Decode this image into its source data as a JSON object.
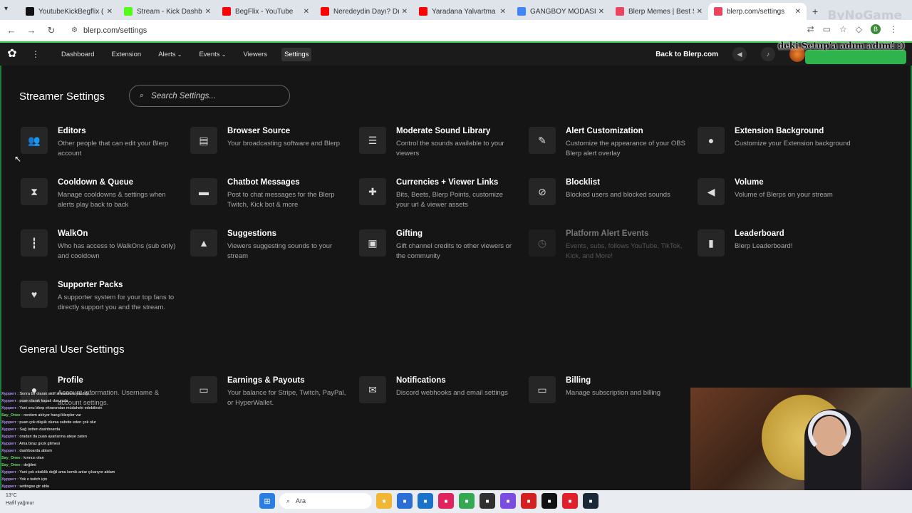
{
  "browser": {
    "tabs": [
      {
        "title": "YoutubeKickBegflix (@you...",
        "color": "#111111",
        "active": false
      },
      {
        "title": "Stream - Kick Dashboard",
        "color": "#53fc18",
        "active": false
      },
      {
        "title": "BegFlix - YouTube",
        "color": "#ff0000",
        "active": false
      },
      {
        "title": "Neredeydin Dayı? Dışarıdı...",
        "color": "#ff0000",
        "active": false
      },
      {
        "title": "Yaradana Yalvartma -",
        "color": "#ff0000",
        "active": false
      },
      {
        "title": "GANGBOY MODASI - Goo...",
        "color": "#4285f4",
        "active": false
      },
      {
        "title": "Blerp Memes | Best Strea...",
        "color": "#e94560",
        "active": false
      },
      {
        "title": "blerp.com/settings",
        "color": "#e94560",
        "active": true
      }
    ],
    "url": "blerp.com/settings",
    "watermark": "ByNoGame",
    "profile_initial": "B"
  },
  "overlay_text": "deki Setup'a adım adım! :)",
  "topnav": {
    "items": [
      {
        "label": "Dashboard",
        "selected": false,
        "dropdown": false
      },
      {
        "label": "Extension",
        "selected": false,
        "dropdown": false
      },
      {
        "label": "Alerts",
        "selected": false,
        "dropdown": true
      },
      {
        "label": "Events",
        "selected": false,
        "dropdown": true
      },
      {
        "label": "Viewers",
        "selected": false,
        "dropdown": false
      },
      {
        "label": "Settings",
        "selected": true,
        "dropdown": false
      }
    ],
    "back_link": "Back to Blerp.com"
  },
  "streamer_settings": {
    "title": "Streamer Settings",
    "search_placeholder": "Search Settings...",
    "cards": [
      {
        "title": "Editors",
        "desc": "Other people that can edit your Blerp account",
        "icon": "people-icon",
        "glyph": "👥",
        "dim": false
      },
      {
        "title": "Browser Source",
        "desc": "Your broadcasting software and Blerp",
        "icon": "browser-icon",
        "glyph": "▤",
        "dim": false
      },
      {
        "title": "Moderate Sound Library",
        "desc": "Control the sounds available to your viewers",
        "icon": "sliders-icon",
        "glyph": "☰",
        "dim": false
      },
      {
        "title": "Alert Customization",
        "desc": "Customize the appearance of your OBS Blerp alert overlay",
        "icon": "magic-wand-icon",
        "glyph": "✎",
        "dim": false
      },
      {
        "title": "Extension Background",
        "desc": "Customize your Extension background",
        "icon": "palette-icon",
        "glyph": "●",
        "dim": false
      },
      {
        "title": "Cooldown & Queue",
        "desc": "Manage cooldowns & settings when alerts play back to back",
        "icon": "hourglass-icon",
        "glyph": "⧗",
        "dim": false
      },
      {
        "title": "Chatbot Messages",
        "desc": "Post to chat messages for the Blerp Twitch, Kick bot & more",
        "icon": "chat-icon",
        "glyph": "▬",
        "dim": false
      },
      {
        "title": "Currencies + Viewer Links",
        "desc": "Bits, Beets, Blerp Points, customize your url & viewer assets",
        "icon": "puzzle-icon",
        "glyph": "✚",
        "dim": false
      },
      {
        "title": "Blocklist",
        "desc": "Blocked users and blocked sounds",
        "icon": "block-icon",
        "glyph": "⊘",
        "dim": false
      },
      {
        "title": "Volume",
        "desc": "Volume of Blerps on your stream",
        "icon": "volume-icon",
        "glyph": "◀",
        "dim": false
      },
      {
        "title": "WalkOn",
        "desc": "Who has access to WalkOns (sub only) and cooldown",
        "icon": "walk-icon",
        "glyph": "┇",
        "dim": false
      },
      {
        "title": "Suggestions",
        "desc": "Viewers suggesting sounds to your stream",
        "icon": "thumbs-up-icon",
        "glyph": "▲",
        "dim": false
      },
      {
        "title": "Gifting",
        "desc": "Gift channel credits to other viewers or the community",
        "icon": "gift-icon",
        "glyph": "▣",
        "dim": false
      },
      {
        "title": "Platform Alert Events",
        "desc": "Events, subs, follows YouTube, TikTok, Kick, and More!",
        "icon": "alarm-icon",
        "glyph": "◷",
        "dim": true
      },
      {
        "title": "Leaderboard",
        "desc": "Blerp Leaderboard!",
        "icon": "bar-chart-icon",
        "glyph": "▮",
        "dim": false
      },
      {
        "title": "Supporter Packs",
        "desc": "A supporter system for your top fans to directly support you and the stream.",
        "icon": "hand-heart-icon",
        "glyph": "♥",
        "dim": false
      }
    ]
  },
  "general_settings": {
    "title": "General User Settings",
    "cards": [
      {
        "title": "Profile",
        "desc": "Account information. Username & account settings.",
        "icon": "person-icon",
        "glyph": "●",
        "dim": false
      },
      {
        "title": "Earnings & Payouts",
        "desc": "Your balance for Stripe, Twitch, PayPal, or HyperWallet.",
        "icon": "wallet-icon",
        "glyph": "▭",
        "dim": false
      },
      {
        "title": "Notifications",
        "desc": "Discord webhooks and email settings",
        "icon": "mail-icon",
        "glyph": "✉",
        "dim": false
      },
      {
        "title": "Billing",
        "desc": "Manage subscription and billing",
        "icon": "credit-card-icon",
        "glyph": "▭",
        "dim": false
      }
    ]
  },
  "chat": [
    {
      "user": "Xypperr",
      "msg": "Sonra bir olarak aktif streamlere yazdığı...",
      "mod": false
    },
    {
      "user": "Xypperr",
      "msg": "puan olarak kapalı durumda",
      "mod": false
    },
    {
      "user": "Xypperr",
      "msg": "Yani onu blerp ekranından müdahele edebilirsin",
      "mod": false
    },
    {
      "user": "Say_Onee",
      "msg": "nerdem atılıyor hangi blerpler var",
      "mod": true
    },
    {
      "user": "Xypperr",
      "msg": "puan çok düşük olursa subote eden çok olur",
      "mod": false
    },
    {
      "user": "Xypperr",
      "msg": "Sağ üstten dashboarda",
      "mod": false
    },
    {
      "user": "Xypperr",
      "msg": "oradan da puan ayarlarına ateye zaten",
      "mod": false
    },
    {
      "user": "Xypperr",
      "msg": "Ama biraz gıcık gitmesi",
      "mod": false
    },
    {
      "user": "Xypperr",
      "msg": "dashboarda ablam",
      "mod": false
    },
    {
      "user": "Say_Onee",
      "msg": "kırmızı olan",
      "mod": true
    },
    {
      "user": "Say_Onee",
      "msg": "değilmi",
      "mod": true
    },
    {
      "user": "Xypperr",
      "msg": "Yani çok eksiklik değil ama komik anlar çıkarıyor ablam",
      "mod": false
    },
    {
      "user": "Xypperr",
      "msg": "Yok o twitch için",
      "mod": false
    },
    {
      "user": "Xypperr",
      "msg": "settingse gir abla",
      "mod": false
    }
  ],
  "taskbar": {
    "weather_temp": "13°C",
    "weather_desc": "Hafif yağmur",
    "search_label": "Ara",
    "apps": [
      {
        "name": "file-explorer-icon",
        "color": "#f2b632"
      },
      {
        "name": "store-icon",
        "color": "#2b6fd6"
      },
      {
        "name": "outlook-icon",
        "color": "#1a73c9"
      },
      {
        "name": "tiktok-icon",
        "color": "#e0245e"
      },
      {
        "name": "chrome-icon",
        "color": "#34a853"
      },
      {
        "name": "obs-icon",
        "color": "#303030"
      },
      {
        "name": "vpn-icon",
        "color": "#7a4de0"
      },
      {
        "name": "l-app-icon",
        "color": "#d42020"
      },
      {
        "name": "tiktok-live-icon",
        "color": "#111111"
      },
      {
        "name": "opera-icon",
        "color": "#e0202a"
      },
      {
        "name": "steam-icon",
        "color": "#1b2838"
      }
    ]
  }
}
